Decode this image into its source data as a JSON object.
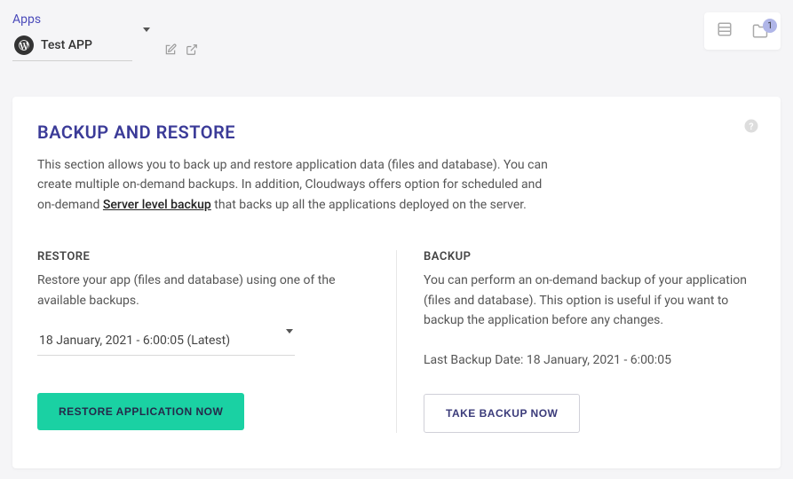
{
  "header": {
    "apps_label": "Apps",
    "app_name": "Test APP",
    "folder_badge": "1"
  },
  "card": {
    "title": "BACKUP AND RESTORE",
    "desc_part1": "This section allows you to back up and restore application data (files and database). You can create multiple on-demand backups. In addition, Cloudways offers option for scheduled and on-demand  ",
    "link_text": "Server level backup",
    "desc_part2": "  that backs up all the applications deployed on the server."
  },
  "restore": {
    "title": "RESTORE",
    "desc": "Restore your app (files and database) using one of the available backups.",
    "selected_backup": "18 January, 2021 - 6:00:05 (Latest)",
    "button": "RESTORE APPLICATION NOW"
  },
  "backup": {
    "title": "BACKUP",
    "desc": "You can perform an on-demand backup of your application (files and database). This option is useful if you want to backup the application before any changes.",
    "last_label": "Last Backup Date: ",
    "last_value": "18 January, 2021 - 6:00:05",
    "button": "TAKE BACKUP NOW"
  }
}
